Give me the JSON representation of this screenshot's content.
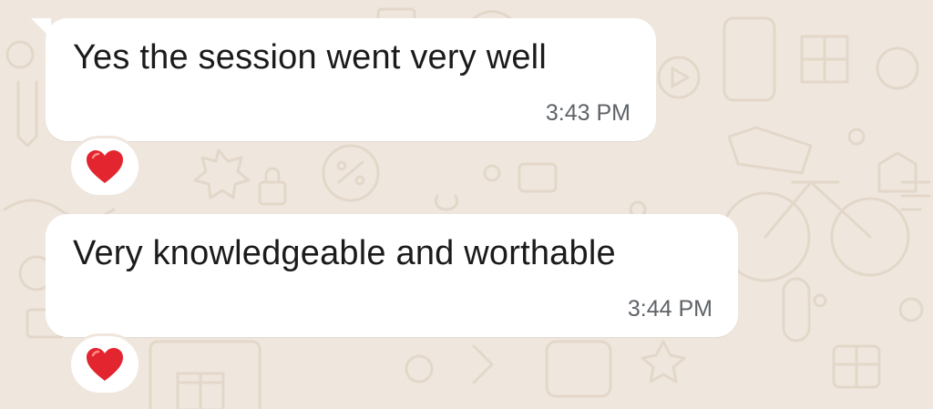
{
  "chat": {
    "messages": [
      {
        "text": "Yes the session went very well",
        "time": "3:43 PM",
        "reaction_icon": "heart-icon"
      },
      {
        "text": "Very knowledgeable and worthable",
        "time": "3:44 PM",
        "reaction_icon": "heart-icon"
      }
    ]
  },
  "colors": {
    "background": "#efe7dd",
    "bubble": "#ffffff",
    "text": "#1b1b1b",
    "timestamp": "#5f6368",
    "reaction_heart": "#e2252f"
  }
}
